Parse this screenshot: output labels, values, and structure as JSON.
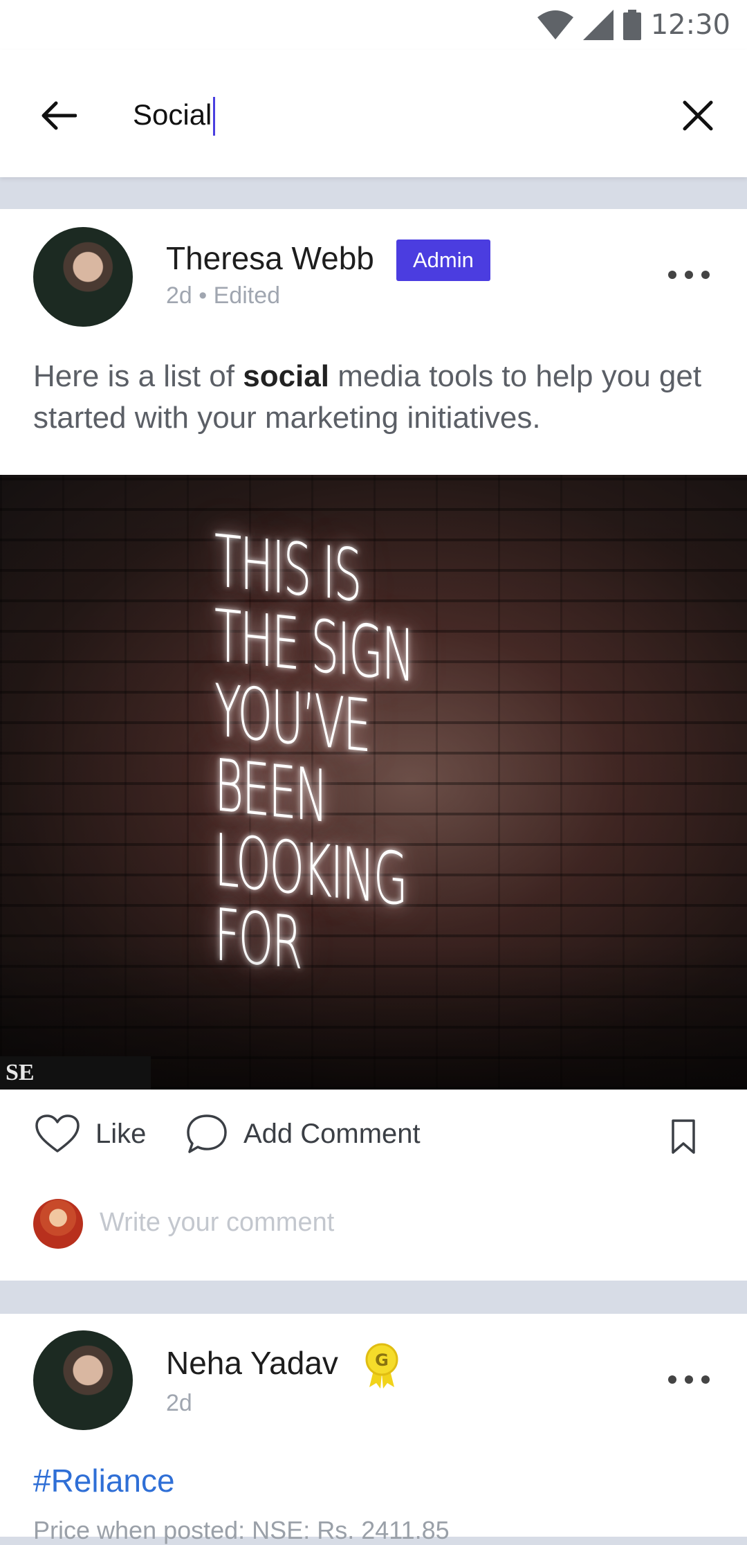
{
  "status_bar": {
    "time": "12:30",
    "icons": [
      "wifi-icon",
      "signal-icon",
      "battery-icon"
    ]
  },
  "search": {
    "value": "Social",
    "back_icon": "arrow-left-icon",
    "clear_icon": "close-icon"
  },
  "posts": [
    {
      "author": "Theresa Webb",
      "badge": "Admin",
      "meta": "2d • Edited",
      "text_before": "Here is a list of ",
      "text_highlight": "social",
      "text_after": " media tools to help you get started with your marketing initiatives.",
      "image": {
        "neon_text": [
          "THIS IS",
          "THE SIGN",
          "YOU’VE BEEN",
          "LOOKING FOR"
        ],
        "sign_text": "SE JEWELRY"
      },
      "actions": {
        "like": "Like",
        "comment": "Add Comment"
      },
      "comment_placeholder": "Write your comment"
    },
    {
      "author": "Neha Yadav",
      "meta": "2d",
      "medal_letter": "G",
      "hashtag": "#Reliance",
      "price_text": "Price when posted: NSE: Rs. 2411.85"
    }
  ],
  "colors": {
    "accent": "#4b3de0",
    "link": "#2f6fd6",
    "divider": "#d7dce6"
  }
}
